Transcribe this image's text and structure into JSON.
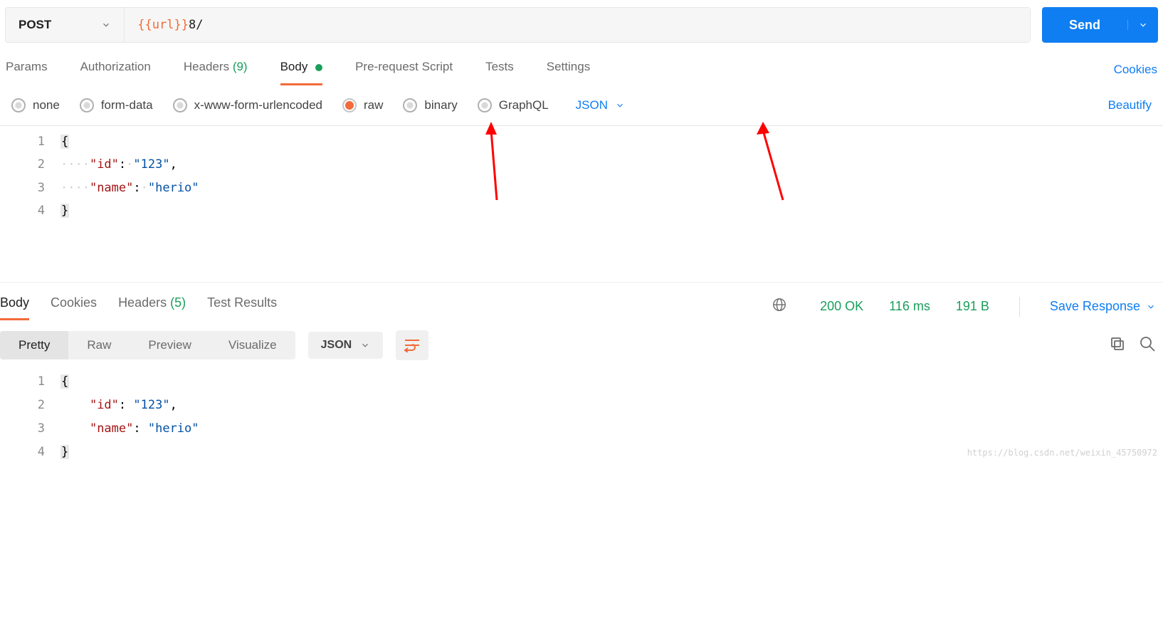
{
  "request": {
    "method": "POST",
    "url_variable": "{{url}}",
    "url_rest": "8/",
    "send_label": "Send"
  },
  "req_tabs": {
    "params": "Params",
    "authorization": "Authorization",
    "headers_label": "Headers",
    "headers_count": "(9)",
    "body": "Body",
    "prerequest": "Pre-request Script",
    "tests": "Tests",
    "settings": "Settings",
    "cookies_link": "Cookies"
  },
  "body_types": {
    "none": "none",
    "form_data": "form-data",
    "xwww": "x-www-form-urlencoded",
    "raw": "raw",
    "binary": "binary",
    "graphql": "GraphQL",
    "format": "JSON",
    "beautify": "Beautify"
  },
  "request_body_lines": {
    "l1": "{",
    "l2_key": "\"id\"",
    "l2_val": "\"123\"",
    "l3_key": "\"name\"",
    "l3_val": "\"herio\"",
    "l4": "}"
  },
  "response_tabs": {
    "body": "Body",
    "cookies": "Cookies",
    "headers_label": "Headers",
    "headers_count": "(5)",
    "test_results": "Test Results"
  },
  "response_status": {
    "code": "200 OK",
    "time": "116 ms",
    "size": "191 B",
    "save_label": "Save Response"
  },
  "view_modes": {
    "pretty": "Pretty",
    "raw": "Raw",
    "preview": "Preview",
    "visualize": "Visualize",
    "format": "JSON"
  },
  "response_body_lines": {
    "l1": "{",
    "l2_key": "\"id\"",
    "l2_val": "\"123\"",
    "l3_key": "\"name\"",
    "l3_val": "\"herio\"",
    "l4": "}"
  },
  "watermark": "https://blog.csdn.net/weixin_45750972"
}
